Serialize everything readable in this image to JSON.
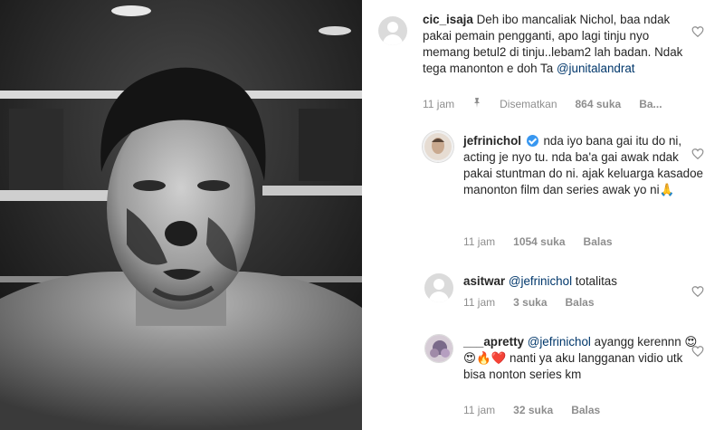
{
  "post": {
    "image_alt": "Black and white photo of a bruised boxer in a ring"
  },
  "comments": [
    {
      "username": "cic_isaja",
      "text": "Deh ibo mancaliak Nichol, baa ndak pakai pemain pengganti, apo lagi tinju nyo memang betul2 di tinju..lebam2 lah badan. Ndak tega manonton e doh Ta",
      "mention": "@junitalandrat",
      "time": "11 jam",
      "pinned_label": "Disematkan",
      "likes": "864 suka",
      "reply": "Ba..."
    },
    {
      "username": "jefrinichol",
      "verified": true,
      "text": "nda iyo bana gai itu do ni, acting je nyo tu. nda ba'a gai awak ndak pakai stuntman do ni. ajak keluarga kasadoe manonton film dan series awak yo ni🙏",
      "time": "11 jam",
      "likes": "1054 suka",
      "reply": "Balas"
    },
    {
      "username": "asitwar",
      "mention": "@jefrinichol",
      "text": "totalitas",
      "time": "11 jam",
      "likes": "3 suka",
      "reply": "Balas"
    },
    {
      "username": "___apretty",
      "mention": "@jefrinichol",
      "text": "ayangg kerennn 😍😍🔥❤️ nanti ya aku langganan vidio utk bisa nonton series km",
      "time": "11 jam",
      "likes": "32 suka",
      "reply": "Balas"
    }
  ],
  "icons": {
    "pin": "pin-icon",
    "like": "heart-outline-icon",
    "verified": "verified-badge-icon"
  },
  "colors": {
    "text": "#262626",
    "muted": "#8e8e8e",
    "mention": "#00376b",
    "verified": "#3897f0"
  }
}
